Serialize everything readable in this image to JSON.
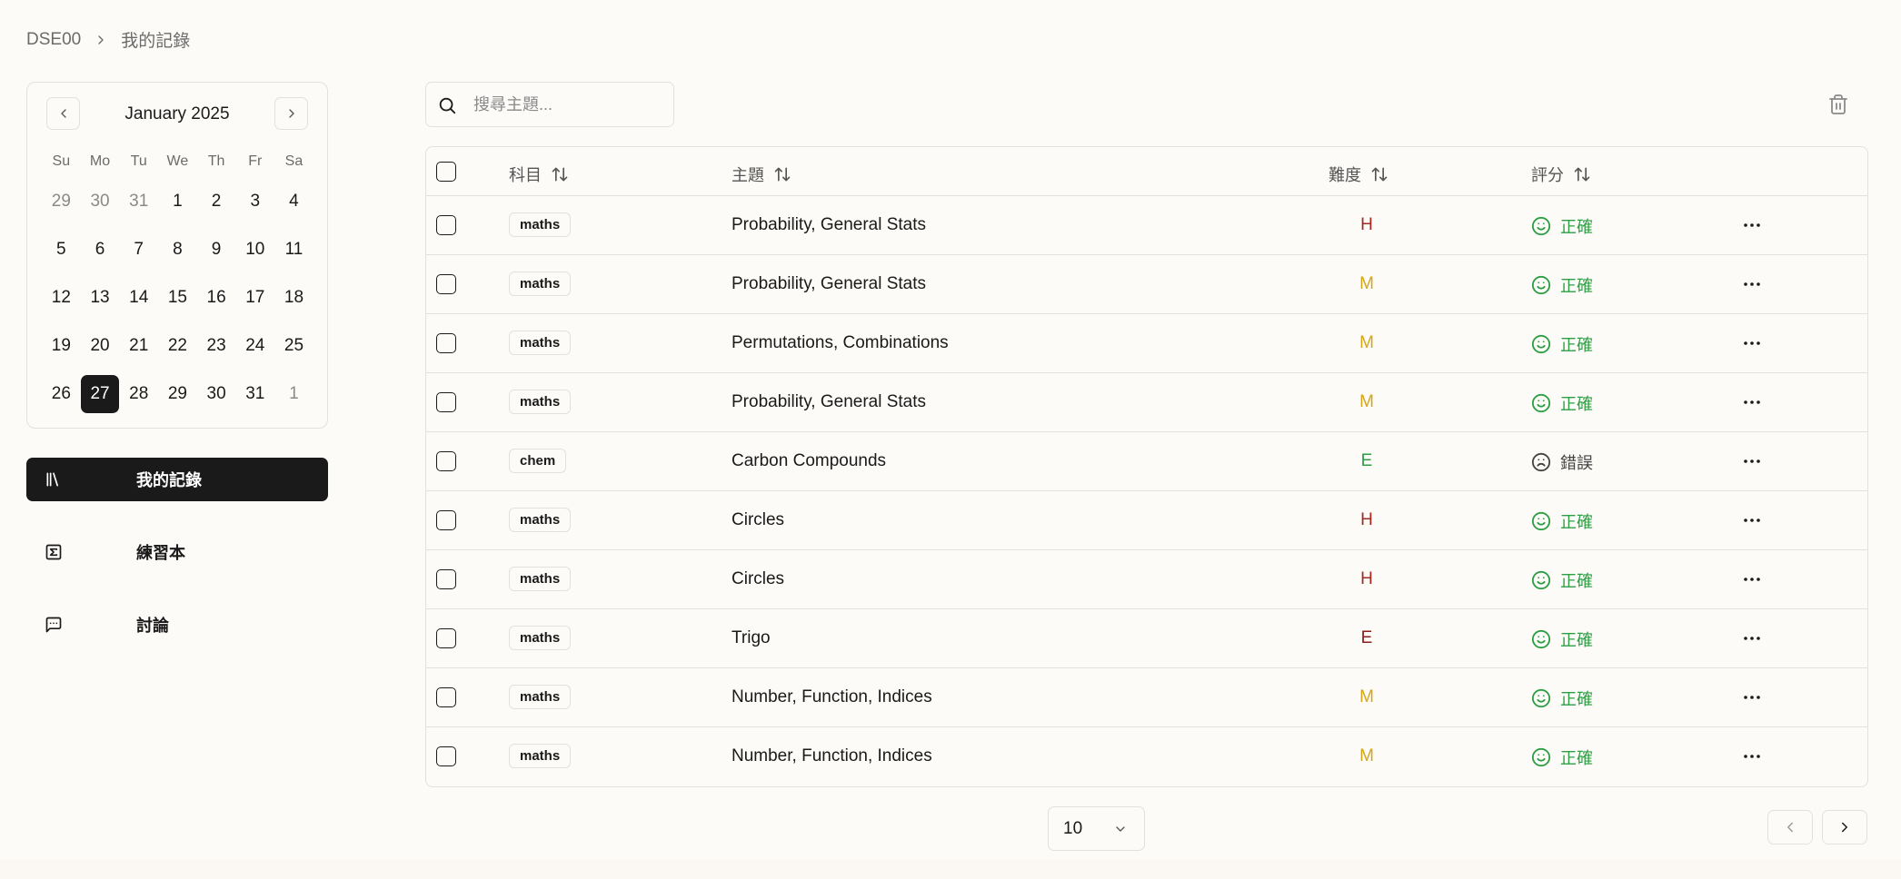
{
  "breadcrumb": {
    "root": "DSE00",
    "current": "我的記錄"
  },
  "calendar": {
    "month_label": "January 2025",
    "weekdays": [
      "Su",
      "Mo",
      "Tu",
      "We",
      "Th",
      "Fr",
      "Sa"
    ],
    "days": [
      {
        "d": "29",
        "muted": true
      },
      {
        "d": "30",
        "muted": true
      },
      {
        "d": "31",
        "muted": true
      },
      {
        "d": "1"
      },
      {
        "d": "2"
      },
      {
        "d": "3"
      },
      {
        "d": "4"
      },
      {
        "d": "5"
      },
      {
        "d": "6"
      },
      {
        "d": "7"
      },
      {
        "d": "8"
      },
      {
        "d": "9"
      },
      {
        "d": "10"
      },
      {
        "d": "11"
      },
      {
        "d": "12"
      },
      {
        "d": "13"
      },
      {
        "d": "14"
      },
      {
        "d": "15"
      },
      {
        "d": "16"
      },
      {
        "d": "17"
      },
      {
        "d": "18"
      },
      {
        "d": "19"
      },
      {
        "d": "20"
      },
      {
        "d": "21"
      },
      {
        "d": "22"
      },
      {
        "d": "23"
      },
      {
        "d": "24"
      },
      {
        "d": "25"
      },
      {
        "d": "26"
      },
      {
        "d": "27",
        "selected": true
      },
      {
        "d": "28"
      },
      {
        "d": "29"
      },
      {
        "d": "30"
      },
      {
        "d": "31"
      },
      {
        "d": "1",
        "muted": true
      }
    ]
  },
  "nav": {
    "records": "我的記錄",
    "workbook": "練習本",
    "discussion": "討論"
  },
  "search": {
    "placeholder": "搜尋主題..."
  },
  "table": {
    "headers": {
      "subject": "科目",
      "topic": "主題",
      "difficulty": "難度",
      "rating": "評分"
    },
    "rows": [
      {
        "subject": "maths",
        "topic": "Probability, General Stats",
        "difficulty": "H",
        "rating": "正確",
        "correct": true
      },
      {
        "subject": "maths",
        "topic": "Probability, General Stats",
        "difficulty": "M",
        "rating": "正確",
        "correct": true
      },
      {
        "subject": "maths",
        "topic": "Permutations, Combinations",
        "difficulty": "M",
        "rating": "正確",
        "correct": true
      },
      {
        "subject": "maths",
        "topic": "Probability, General Stats",
        "difficulty": "M",
        "rating": "正確",
        "correct": true
      },
      {
        "subject": "chem",
        "topic": "Carbon Compounds",
        "difficulty": "E",
        "rating": "錯誤",
        "correct": false
      },
      {
        "subject": "maths",
        "topic": "Circles",
        "difficulty": "H",
        "rating": "正確",
        "correct": true
      },
      {
        "subject": "maths",
        "topic": "Circles",
        "difficulty": "H",
        "rating": "正確",
        "correct": true
      },
      {
        "subject": "maths",
        "topic": "Trigo",
        "difficulty": "E",
        "rating": "正確",
        "correct": true
      },
      {
        "subject": "maths",
        "topic": "Number, Function, Indices",
        "difficulty": "M",
        "rating": "正確",
        "correct": true
      },
      {
        "subject": "maths",
        "topic": "Number, Function, Indices",
        "difficulty": "M",
        "rating": "正確",
        "correct": true
      }
    ]
  },
  "pagination": {
    "page_size": "10"
  },
  "colors": {
    "difficulty": {
      "H": "#a3281f",
      "M": "#d4a618",
      "E_green": "#2e9e45",
      "E_red": "#8b1d1d"
    },
    "correct": "#2e9e45",
    "wrong": "#444444",
    "accent": "#1a1a1a"
  }
}
